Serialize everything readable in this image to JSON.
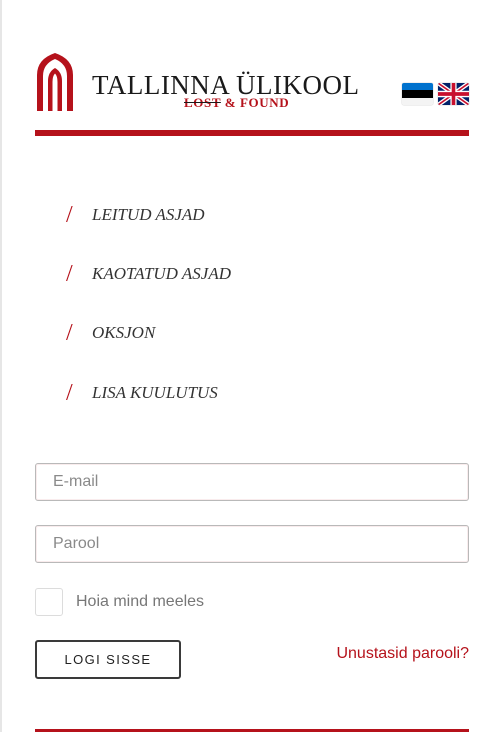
{
  "header": {
    "title": "TALLINNA ÜLIKOOL",
    "subtitle_strike": "LOST",
    "subtitle_rest": " & FOUND",
    "brand_color": "#b5121b",
    "languages": [
      {
        "code": "et",
        "icon": "estonian-flag-icon"
      },
      {
        "code": "en",
        "icon": "uk-flag-icon"
      }
    ]
  },
  "nav": {
    "slash": "/",
    "items": [
      {
        "label": "LEITUD ASJAD"
      },
      {
        "label": "KAOTATUD ASJAD"
      },
      {
        "label": "OKSJON"
      },
      {
        "label": "LISA KUULUTUS"
      }
    ]
  },
  "login": {
    "email_placeholder": "E-mail",
    "email_value": "",
    "password_placeholder": "Parool",
    "password_value": "",
    "remember_label": "Hoia mind meeles",
    "remember_checked": false,
    "submit_label": "LOGI SISSE",
    "forgot_label": "Unustasid parooli?"
  }
}
